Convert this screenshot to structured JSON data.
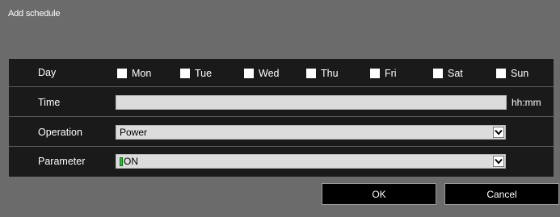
{
  "dialog": {
    "title": "Add schedule"
  },
  "form": {
    "day": {
      "label": "Day",
      "options": [
        {
          "label": "Mon",
          "checked": false
        },
        {
          "label": "Tue",
          "checked": false
        },
        {
          "label": "Wed",
          "checked": false
        },
        {
          "label": "Thu",
          "checked": false
        },
        {
          "label": "Fri",
          "checked": false
        },
        {
          "label": "Sat",
          "checked": false
        },
        {
          "label": "Sun",
          "checked": false
        }
      ]
    },
    "time": {
      "label": "Time",
      "value": "",
      "unit": "hh:mm"
    },
    "operation": {
      "label": "Operation",
      "selected": "Power"
    },
    "parameter": {
      "label": "Parameter",
      "selected": "ON",
      "indicator_color": "#2fbf3a"
    }
  },
  "buttons": {
    "ok_label": "OK",
    "cancel_label": "Cancel"
  },
  "colors": {
    "background": "#6b6b6b",
    "panel": "#1a1a1a",
    "field": "#dcdcdc",
    "button": "#000000"
  }
}
